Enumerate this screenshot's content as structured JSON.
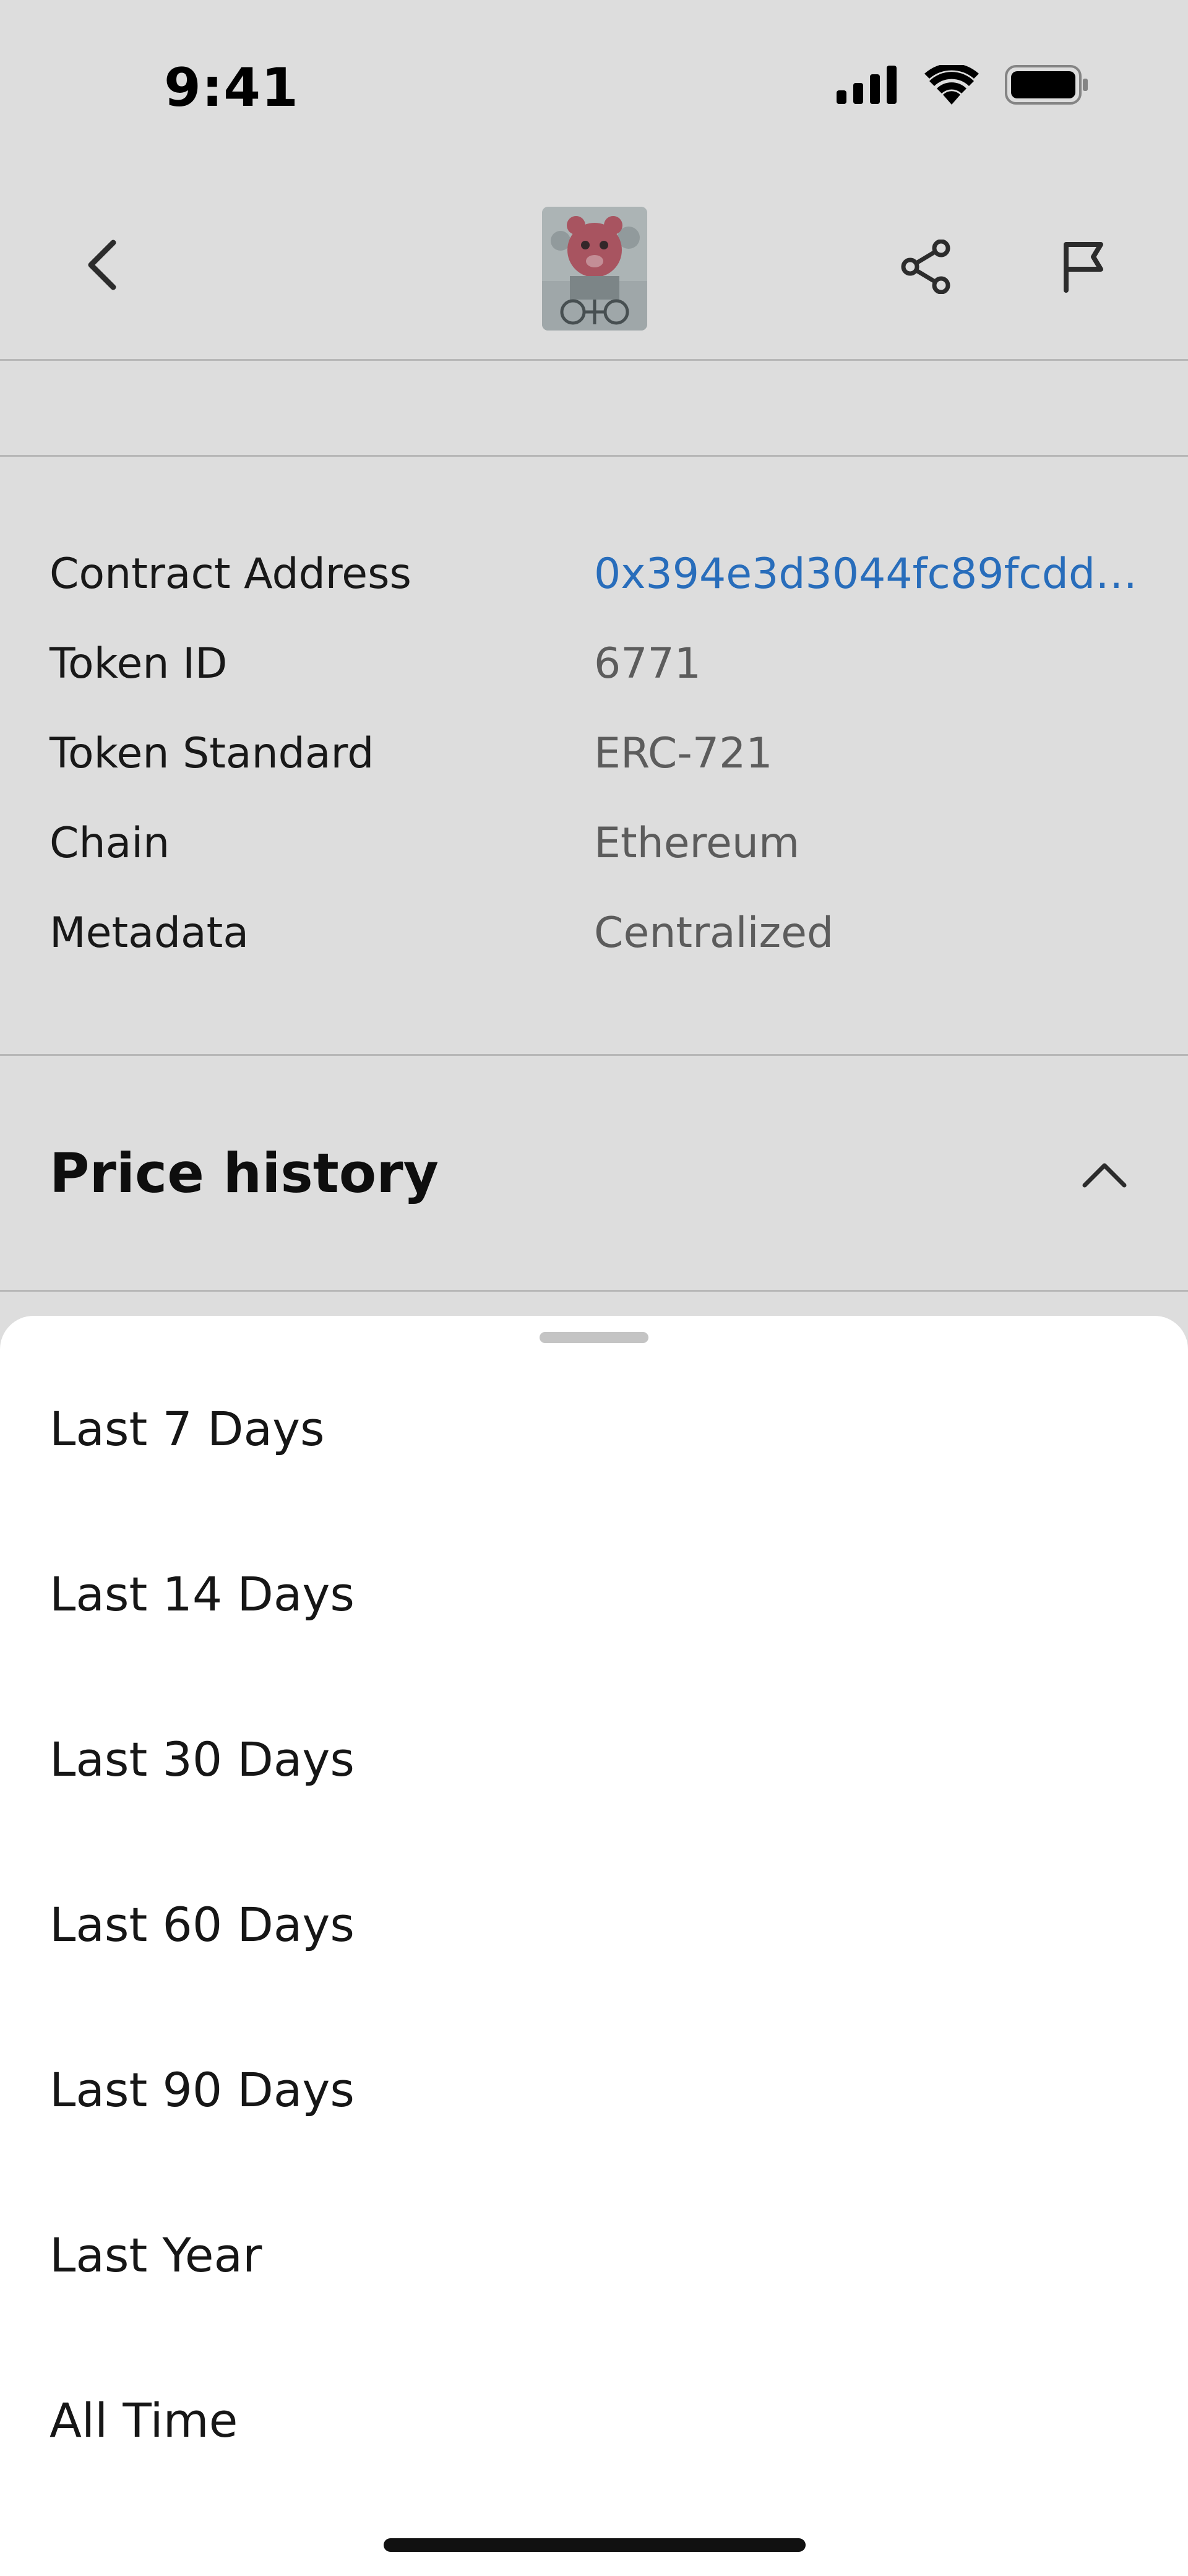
{
  "status_bar": {
    "time": "9:41",
    "icons": [
      "signal-icon",
      "wifi-icon",
      "battery-icon"
    ]
  },
  "nav": {
    "back_icon": "chevron-left-icon",
    "thumbnail_icon": "nft-thumbnail",
    "share_icon": "share-icon",
    "flag_icon": "flag-icon"
  },
  "details": [
    {
      "label": "Contract Address",
      "value": "0x394e3d3044fc89fcdd…",
      "is_link": true
    },
    {
      "label": "Token ID",
      "value": "6771",
      "is_link": false
    },
    {
      "label": "Token Standard",
      "value": "ERC-721",
      "is_link": false
    },
    {
      "label": "Chain",
      "value": "Ethereum",
      "is_link": false
    },
    {
      "label": "Metadata",
      "value": "Centralized",
      "is_link": false
    }
  ],
  "price_history": {
    "title": "Price history",
    "toggle_icon": "chevron-up-icon"
  },
  "sheet": {
    "options": [
      "Last 7 Days",
      "Last 14 Days",
      "Last 30 Days",
      "Last 60 Days",
      "Last 90 Days",
      "Last Year",
      "All Time"
    ]
  },
  "colors": {
    "link": "#2f7ed8",
    "secondary_text": "#6b6b6b",
    "primary_text": "#111111",
    "divider": "#d4d4d4"
  }
}
